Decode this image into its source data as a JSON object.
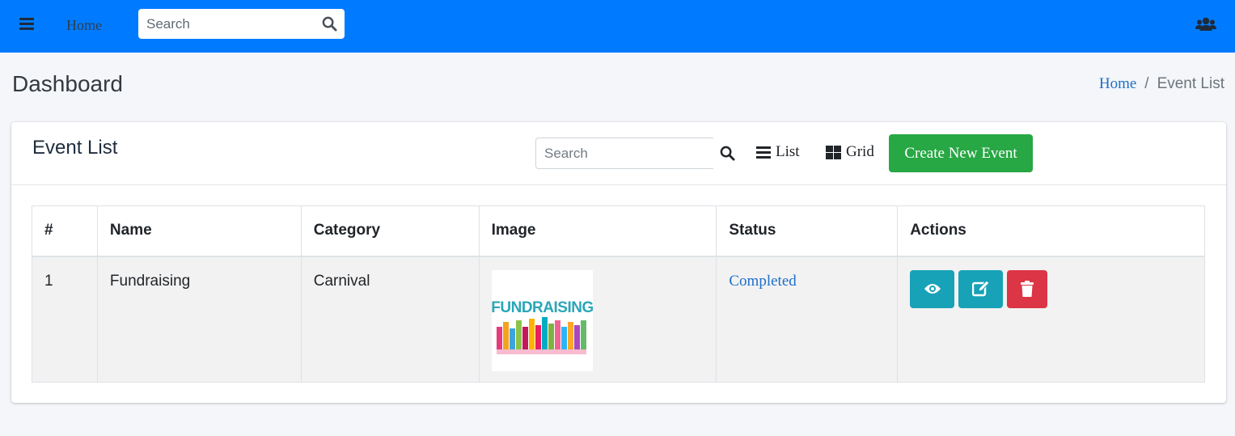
{
  "navbar": {
    "home_label": "Home",
    "search_placeholder": "Search",
    "menu_icon": "bars-icon",
    "search_icon": "search-icon",
    "users_icon": "users-icon"
  },
  "header": {
    "title": "Dashboard",
    "breadcrumb": {
      "home": "Home",
      "separator": "/",
      "current": "Event List"
    }
  },
  "card": {
    "title": "Event List",
    "search_placeholder": "Search",
    "list_label": "List",
    "grid_label": "Grid",
    "create_label": "Create New Event"
  },
  "table": {
    "headers": [
      "#",
      "Name",
      "Category",
      "Image",
      "Status",
      "Actions"
    ],
    "rows": [
      {
        "num": "1",
        "name": "Fundraising",
        "category": "Carnival",
        "image_text": "FUNDRAISING",
        "status": "Completed",
        "actions": [
          "eye-icon",
          "edit-icon",
          "trash-icon"
        ]
      }
    ]
  },
  "colors": {
    "navbar": "#007bff",
    "create_button": "#28a745",
    "info_button": "#17a2b8",
    "danger_button": "#dc3545",
    "status_link": "#1c6fc9"
  }
}
